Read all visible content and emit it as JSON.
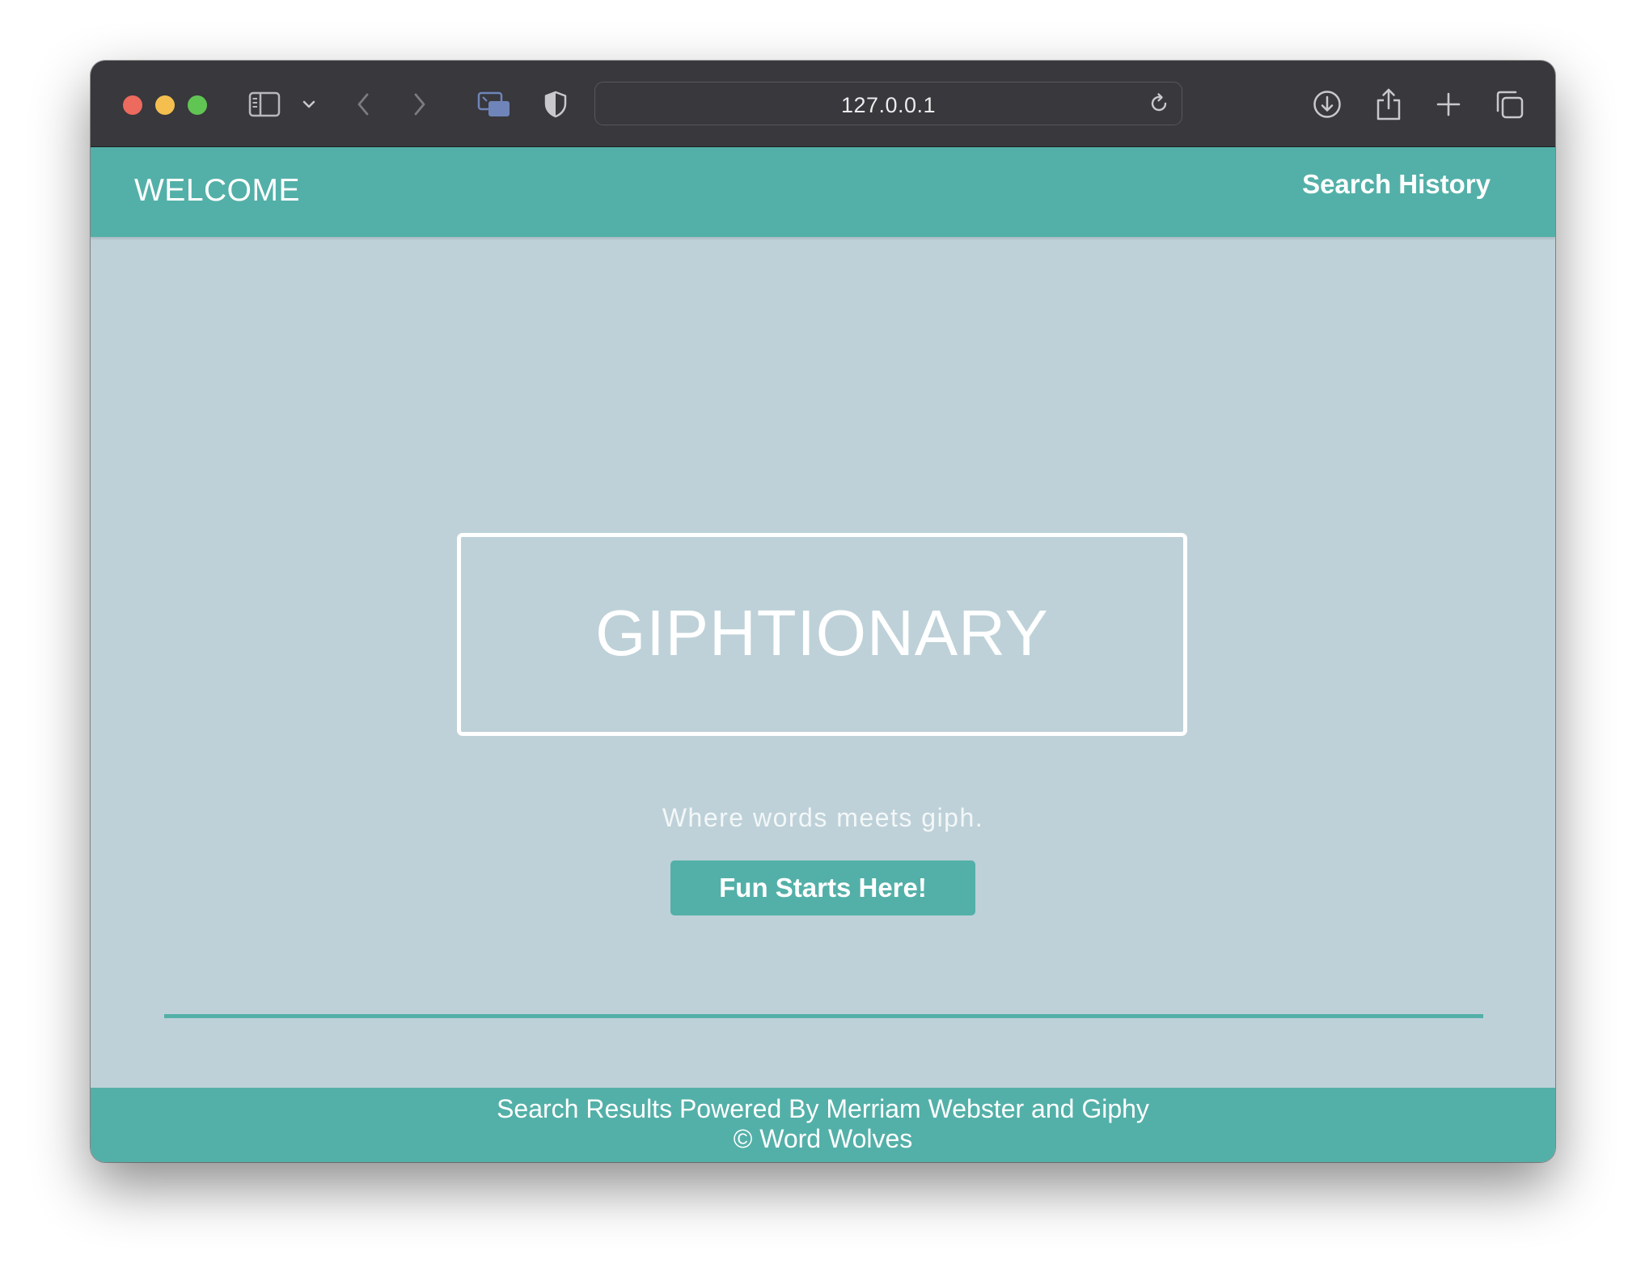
{
  "browser": {
    "url": "127.0.0.1",
    "icons": {
      "sidebar": "sidebar-icon",
      "tab_overview_dropdown": "chevron-down-icon",
      "back": "chevron-left-icon",
      "forward": "chevron-right-icon",
      "picture_in_picture": "picture-in-picture-icon",
      "privacy": "shield-icon",
      "reload": "reload-icon",
      "downloads": "download-icon",
      "share": "share-icon",
      "new_tab": "plus-icon",
      "tabs": "tabs-icon"
    }
  },
  "nav": {
    "brand": "WELCOME",
    "history_link": "Search History"
  },
  "hero": {
    "title": "GIPHTIONARY",
    "tagline": "Where words meets giph.",
    "cta_label": "Fun Starts Here!"
  },
  "footer": {
    "line1": "Search Results Powered By Merriam Webster and Giphy",
    "line2": "© Word Wolves"
  },
  "colors": {
    "accent": "#53b0a8",
    "page_background": "#bed1d8",
    "toolbar": "#38383d"
  }
}
